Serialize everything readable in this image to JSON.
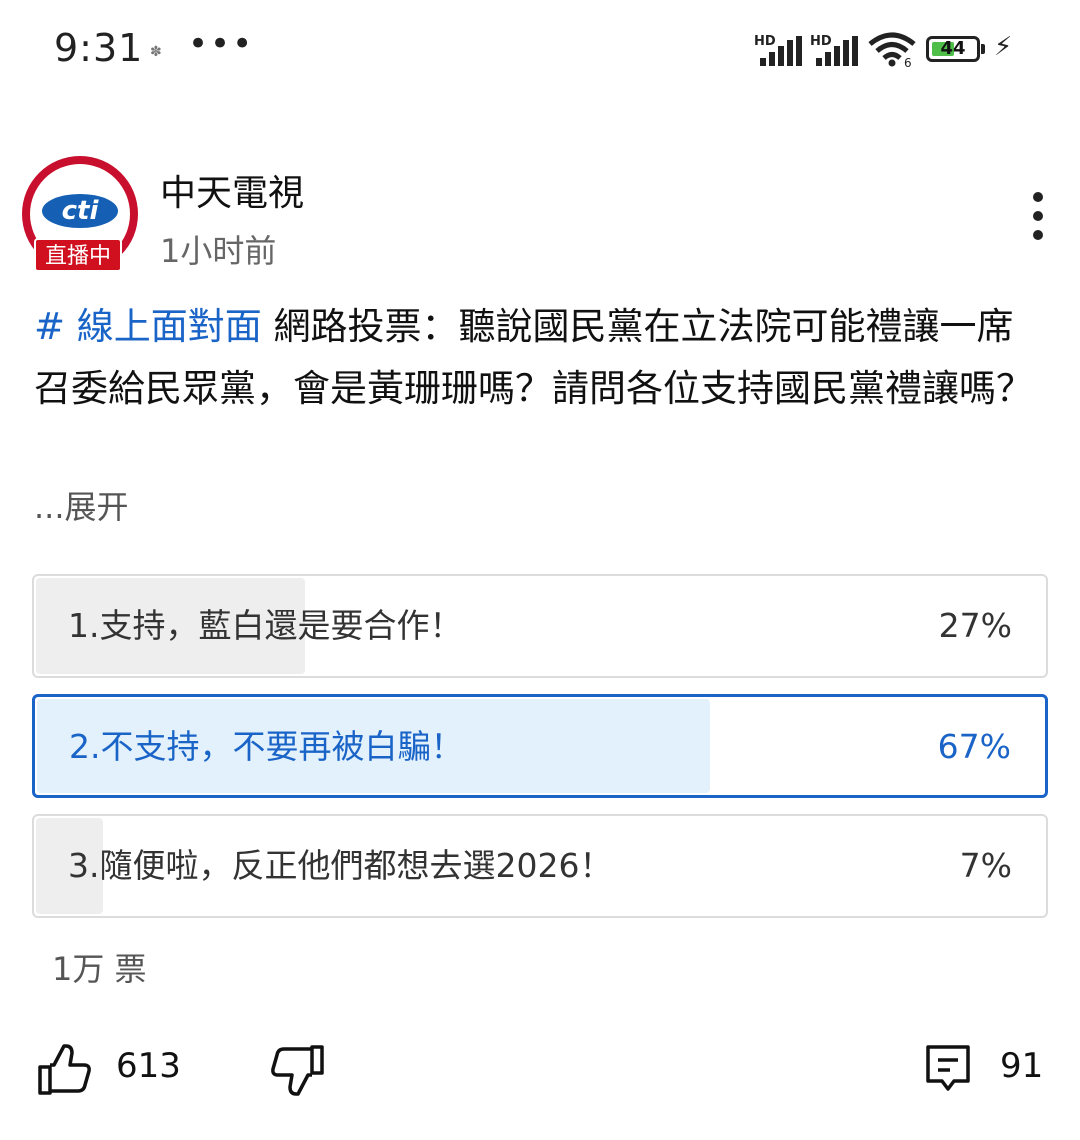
{
  "status_bar": {
    "time": "9:31",
    "indicator": "•••",
    "signal_1_label": "HD",
    "signal_2_label": "HD",
    "wifi_badge": "6",
    "battery": "44"
  },
  "post": {
    "channel_name": "中天電視",
    "time_ago": "1小时前",
    "live_badge": "直播中",
    "avatar_logo_text": "cti",
    "hashtag": "# 線上面對面",
    "body": " 網路投票：聽說國民黨在立法院可能禮讓一席召委給民眾黨，會是黃珊珊嗎？請問各位支持國民黨禮讓嗎？",
    "expand_label": "...展开"
  },
  "poll": {
    "options": [
      {
        "label": "1.支持，藍白還是要合作！",
        "percent": "27%",
        "value": 27,
        "selected": false
      },
      {
        "label": "2.不支持，不要再被白騙！",
        "percent": "67%",
        "value": 67,
        "selected": true
      },
      {
        "label": "3.隨便啦，反正他們都想去選2026！",
        "percent": "7%",
        "value": 7,
        "selected": false
      }
    ],
    "vote_count": "1万 票"
  },
  "actions": {
    "like_count": "613",
    "comment_count": "91"
  },
  "colors": {
    "accent": "#1a64c8",
    "live_red": "#d0101e",
    "selected_fill": "#e2f1fc",
    "fill_gray": "#eeeeee"
  },
  "icons": [
    "thumbs-up-icon",
    "thumbs-down-icon",
    "comment-icon",
    "more-vert-icon",
    "wifi-icon",
    "battery-icon",
    "bolt-icon"
  ]
}
